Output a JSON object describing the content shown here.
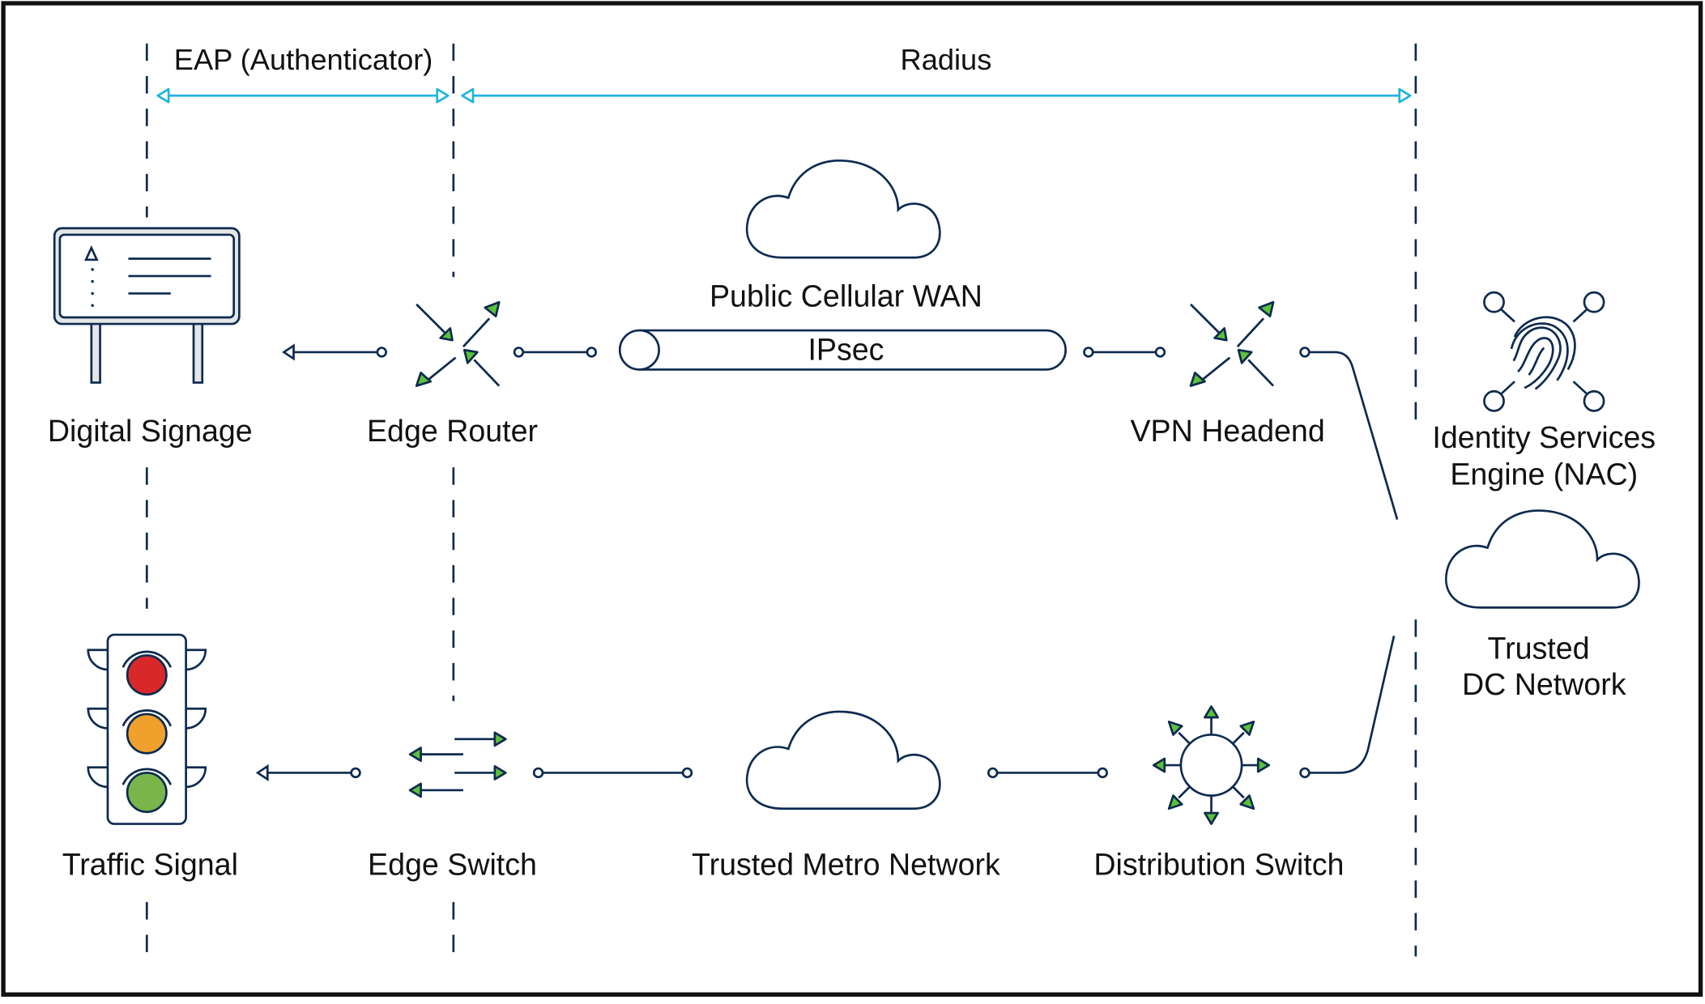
{
  "diagram": {
    "zones": {
      "eap_label": "EAP (Authenticator)",
      "radius_label": "Radius"
    },
    "nodes": {
      "digital_signage": "Digital Signage",
      "edge_router": "Edge Router",
      "public_wan": "Public Cellular WAN",
      "ipsec": "IPsec",
      "vpn_headend": "VPN Headend",
      "ise_line1": "Identity Services",
      "ise_line2": "Engine (NAC)",
      "trusted_dc_line1": "Trusted",
      "trusted_dc_line2": "DC Network",
      "traffic_signal": "Traffic Signal",
      "edge_switch": "Edge Switch",
      "trusted_metro": "Trusted Metro Network",
      "distribution_switch": "Distribution Switch"
    },
    "icons": {
      "digital_signage": "billboard-icon",
      "edge_router": "router-icon",
      "public_wan": "cloud-icon",
      "ipsec": "tunnel-icon",
      "vpn_headend": "router-icon",
      "ise": "fingerprint-icon",
      "trusted_dc": "cloud-icon",
      "traffic_signal": "traffic-light-icon",
      "edge_switch": "switch-icon",
      "trusted_metro": "cloud-icon",
      "distribution_switch": "hub-icon"
    },
    "colors": {
      "ink": "#0d2a4f",
      "accent_cyan": "#1fb3e0",
      "arrow_green": "#5cc13a",
      "light_red": "#d8282a",
      "light_amber": "#efa02d",
      "light_green": "#79b54b",
      "signage_frame": "#e6e6e6"
    }
  }
}
